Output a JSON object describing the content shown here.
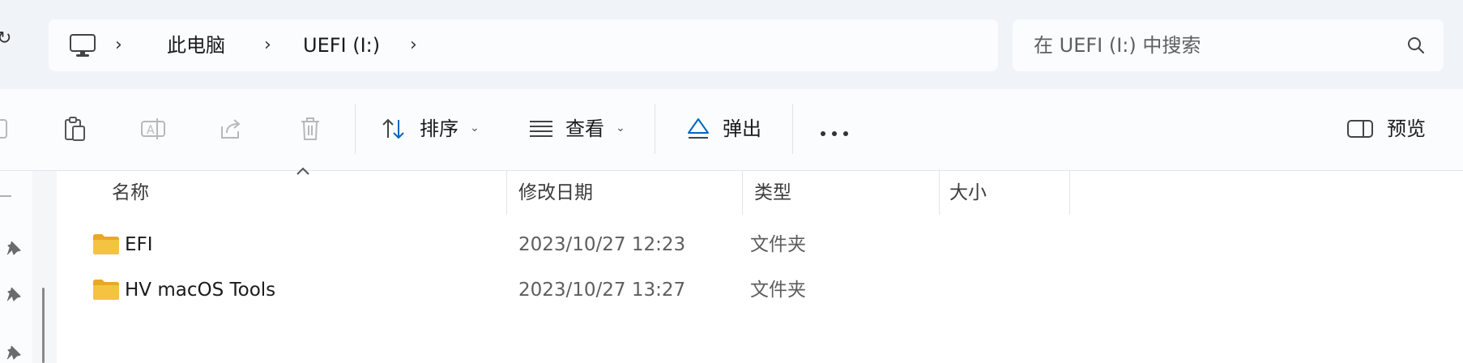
{
  "address": {
    "breadcrumbs": [
      "此电脑",
      "UEFI (I:)"
    ],
    "search_placeholder": "在 UEFI (I:) 中搜索"
  },
  "toolbar": {
    "sort_label": "排序",
    "view_label": "查看",
    "eject_label": "弹出",
    "preview_label": "预览"
  },
  "columns": {
    "name": "名称",
    "modified": "修改日期",
    "type": "类型",
    "size": "大小"
  },
  "files": [
    {
      "name": "EFI",
      "modified": "2023/10/27 12:23",
      "type": "文件夹",
      "size": ""
    },
    {
      "name": "HV macOS Tools",
      "modified": "2023/10/27 13:27",
      "type": "文件夹",
      "size": ""
    }
  ],
  "colors": {
    "accent": "#0067c0",
    "folder": "#f5c342"
  }
}
